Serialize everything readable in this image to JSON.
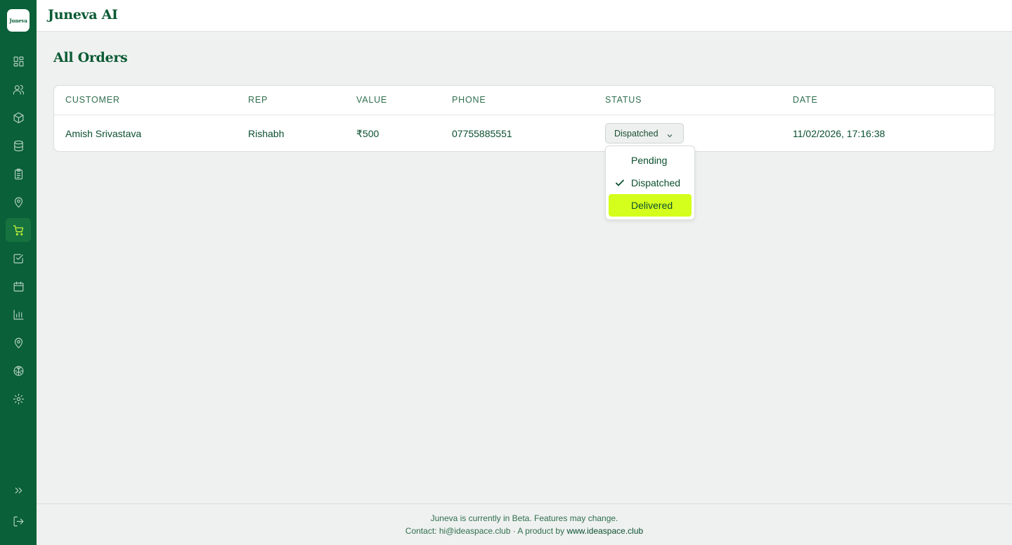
{
  "app": {
    "logo_text": "Juneva",
    "title": "Juneva AI"
  },
  "sidebar": {
    "items": [
      {
        "icon": "dashboard-icon"
      },
      {
        "icon": "users-icon"
      },
      {
        "icon": "box-icon"
      },
      {
        "icon": "database-icon"
      },
      {
        "icon": "clipboard-icon"
      },
      {
        "icon": "location-pin-icon"
      },
      {
        "icon": "cart-icon",
        "active": true
      },
      {
        "icon": "checkbox-icon"
      },
      {
        "icon": "calendar-icon"
      },
      {
        "icon": "bar-chart-icon"
      },
      {
        "icon": "map-pin-icon"
      },
      {
        "icon": "brain-icon"
      },
      {
        "icon": "gear-icon"
      }
    ],
    "expand_icon": "chevrons-right-icon",
    "logout_icon": "logout-icon"
  },
  "page": {
    "title": "All Orders"
  },
  "table": {
    "columns": [
      "CUSTOMER",
      "REP",
      "VALUE",
      "PHONE",
      "STATUS",
      "DATE"
    ],
    "rows": [
      {
        "customer": "Amish Srivastava",
        "rep": "Rishabh",
        "value": "₹500",
        "phone": "07755885551",
        "status": "Dispatched",
        "date": "11/02/2026, 17:16:38"
      }
    ]
  },
  "status_dropdown": {
    "options": [
      "Pending",
      "Dispatched",
      "Delivered"
    ],
    "selected": "Dispatched",
    "highlighted": "Delivered"
  },
  "footer": {
    "line1": "Juneva is currently in Beta. Features may change.",
    "line2_prefix": "Contact: hi@ideaspace.club · A product by ",
    "line2_link": "www.ideaspace.club"
  },
  "colors": {
    "sidebar_bg": "#0a6038",
    "accent": "#d4ff1c",
    "brand_text": "#0a5a34",
    "page_bg": "#eff1f0"
  }
}
